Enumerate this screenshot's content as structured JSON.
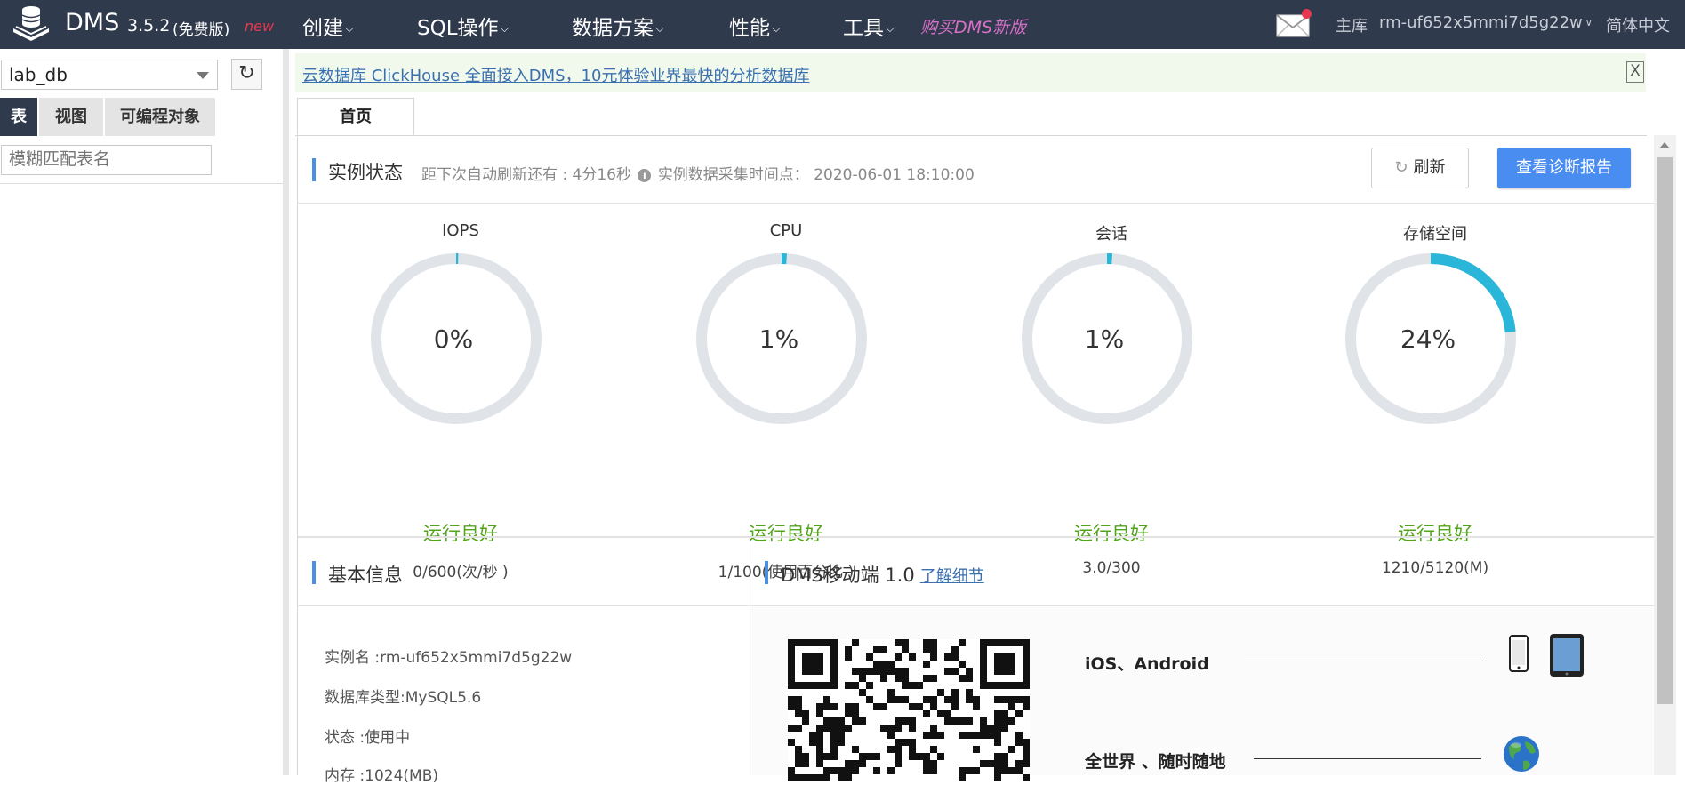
{
  "app": {
    "brand": "DMS",
    "version": "3.5.2",
    "edition": "(免费版)",
    "new_tag": "new",
    "logo_icon": "database-stack-icon"
  },
  "nav": {
    "items": [
      {
        "label": "创建"
      },
      {
        "label": "SQL操作"
      },
      {
        "label": "数据方案"
      },
      {
        "label": "性能"
      },
      {
        "label": "工具"
      }
    ],
    "promo": "购买DMS新版",
    "mail_icon": "mail-icon",
    "master_label": "主库",
    "instance": "rm-uf652x5mmi7d5g22w",
    "language": "简体中文"
  },
  "sidebar": {
    "database": "lab_db",
    "refresh_icon": "refresh-icon",
    "tabs": [
      {
        "label": "表"
      },
      {
        "label": "视图"
      },
      {
        "label": "可编程对象"
      }
    ],
    "filter_placeholder": "模糊匹配表名"
  },
  "banner": {
    "text": "云数据库 ClickHouse 全面接入DMS，10元体验业界最快的分析数据库",
    "close": "X"
  },
  "tabs": {
    "home": "首页"
  },
  "instance_status": {
    "title": "实例状态",
    "refresh_prefix": "距下次自动刷新还有 : ",
    "refresh_countdown": "4分16秒",
    "collect_label": "实例数据采集时间点：",
    "collect_time": "2020-06-01 18:10:00",
    "refresh_button": "刷新",
    "report_button": "查看诊断报告",
    "accent_color": "#29b6d8",
    "track_color": "#e0e3e8",
    "ok_color": "#52a51b",
    "gauges": [
      {
        "label": "IOPS",
        "percent_text": "0%",
        "fraction": 0.0,
        "state": "运行良好",
        "detail": "0/600(次/秒 )"
      },
      {
        "label": "CPU",
        "percent_text": "1%",
        "fraction": 0.01,
        "state": "运行良好",
        "detail": "1/100(使用百分比 )"
      },
      {
        "label": "会话",
        "percent_text": "1%",
        "fraction": 0.01,
        "state": "运行良好",
        "detail": "3.0/300"
      },
      {
        "label": "存储空间",
        "percent_text": "24%",
        "fraction": 0.2363,
        "state": "运行良好",
        "detail": "1210/5120(M)"
      }
    ]
  },
  "basic_info": {
    "title": "基本信息",
    "lines": [
      "实例名 :rm-uf652x5mmi7d5g22w",
      "数据库类型:MySQL5.6",
      "状态 :使用中",
      "内存 :1024(MB)"
    ]
  },
  "mobile": {
    "title": "DMS移动端 1.0",
    "learn_more": "了解细节",
    "features": [
      {
        "text": "iOS、Android",
        "icons": [
          "phone-icon",
          "tablet-icon"
        ]
      },
      {
        "text": "全世界 、随时随地",
        "icons": [
          "globe-icon"
        ]
      }
    ]
  }
}
